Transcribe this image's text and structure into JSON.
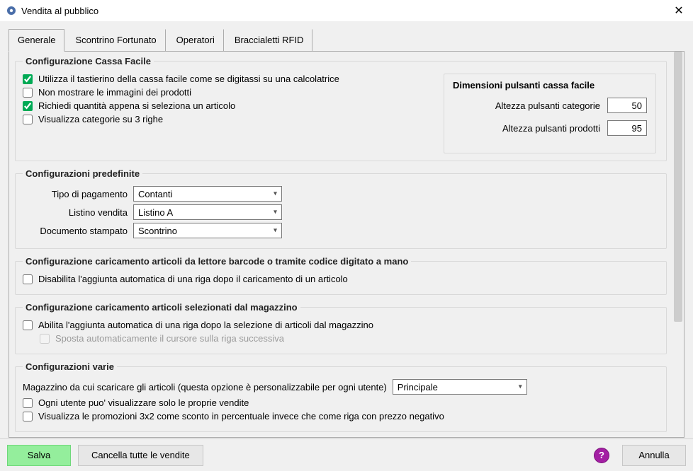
{
  "window": {
    "title": "Vendita al pubblico"
  },
  "tabs": {
    "items": [
      {
        "label": "Generale",
        "active": true
      },
      {
        "label": "Scontrino Fortunato",
        "active": false
      },
      {
        "label": "Operatori",
        "active": false
      },
      {
        "label": "Braccialetti RFID",
        "active": false
      }
    ]
  },
  "cassa_facile": {
    "legend": "Configurazione Cassa Facile",
    "chk_tastierino": {
      "label": "Utilizza il tastierino della cassa facile come se digitassi su una calcolatrice",
      "checked": true
    },
    "chk_no_immagini": {
      "label": "Non mostrare le immagini dei prodotti",
      "checked": false
    },
    "chk_richiedi_qta": {
      "label": "Richiedi quantità appena si seleziona un articolo",
      "checked": true
    },
    "chk_cat_3righe": {
      "label": "Visualizza categorie su 3 righe",
      "checked": false
    },
    "dim": {
      "title": "Dimensioni pulsanti cassa facile",
      "altezza_categorie_label": "Altezza pulsanti categorie",
      "altezza_categorie_value": "50",
      "altezza_prodotti_label": "Altezza pulsanti prodotti",
      "altezza_prodotti_value": "95"
    }
  },
  "predefinite": {
    "legend": "Configurazioni predefinite",
    "pagamento_label": "Tipo di pagamento",
    "pagamento_value": "Contanti",
    "listino_label": "Listino vendita",
    "listino_value": "Listino A",
    "documento_label": "Documento stampato",
    "documento_value": "Scontrino"
  },
  "barcode": {
    "legend": "Configurazione caricamento articoli da lettore barcode o tramite codice digitato a mano",
    "chk_disabilita": {
      "label": "Disabilita l'aggiunta automatica di una riga dopo il caricamento di un articolo",
      "checked": false
    }
  },
  "magazzino_sel": {
    "legend": "Configurazione caricamento articoli selezionati dal magazzino",
    "chk_abilita": {
      "label": "Abilita l'aggiunta automatica di una riga dopo la selezione di articoli dal magazzino",
      "checked": false
    },
    "chk_sposta": {
      "label": "Sposta automaticamente il cursore sulla riga successiva",
      "checked": false
    }
  },
  "varie": {
    "legend": "Configurazioni varie",
    "magazzino_label": "Magazzino da cui scaricare gli articoli (questa opzione è personalizzabile per ogni utente)",
    "magazzino_value": "Principale",
    "chk_solo_proprie": {
      "label": "Ogni utente puo' visualizzare solo le proprie vendite",
      "checked": false
    },
    "chk_promo3x2": {
      "label": "Visualizza le promozioni 3x2 come sconto in percentuale invece che come riga con prezzo negativo",
      "checked": false
    }
  },
  "footer": {
    "save": "Salva",
    "cancel_all": "Cancella tutte le vendite",
    "annulla": "Annulla",
    "help": "?"
  }
}
